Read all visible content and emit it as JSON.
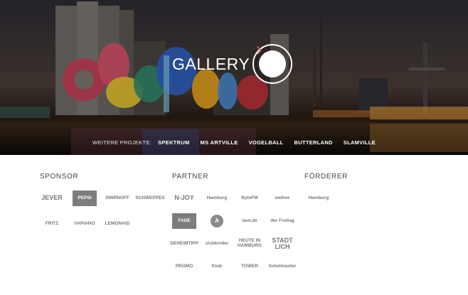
{
  "hero": {
    "gallery_label": "GALLERY",
    "projects_lead": "WEITERE PROJEKTE:",
    "projects": [
      "SPEKTRUM",
      "MS ARTVILLE",
      "VOGELBALL",
      "BUTTERLAND",
      "SLAMVILLE"
    ],
    "arrow_icon": "chevron-right-icon"
  },
  "sponsor": {
    "heading": "SPONSOR",
    "logos": [
      "JEVER",
      "PEPSI",
      "SMIRNOFF",
      "SCHWEPPES",
      "FRITZ",
      "VAPIANO",
      "LEMONAID"
    ]
  },
  "partner": {
    "heading": "PARTNER",
    "logos": [
      "N-JOY",
      "Hamburg",
      "ByteFM",
      "wefree",
      "FADE",
      "A",
      "taut.de",
      "der Freitag",
      "GEHEIMTIPP",
      "clubkinder",
      "HEUTE IN HAMBURG",
      "STADT LICH",
      "PROMO",
      "Klub",
      "TOWER",
      "ticketmaster"
    ]
  },
  "foerderer": {
    "heading": "FÖRDERER",
    "logos": [
      "Hamburg"
    ]
  },
  "colors": {
    "accent": "#d45a5a",
    "text": "#444444"
  }
}
